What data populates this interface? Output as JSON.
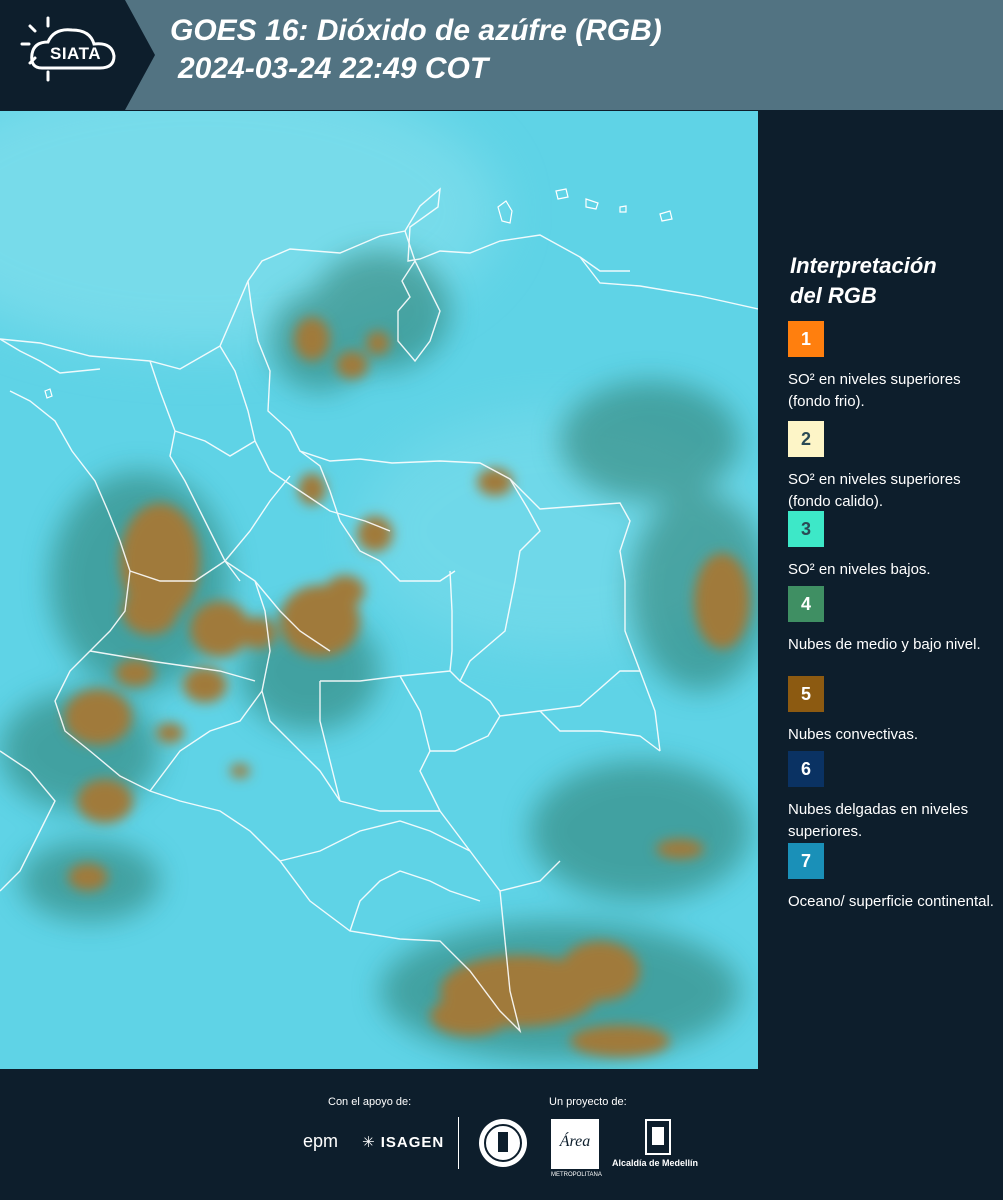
{
  "header": {
    "logo_text": "SIATA",
    "title_line1": "GOES 16: Dióxido de azúfre (RGB)",
    "title_line2": "2024-03-24 22:49 COT"
  },
  "map": {
    "background_color": "#5fd3e6",
    "convective_color": "#a07a3a",
    "border_color": "#ffffff"
  },
  "legend": {
    "title_line1": "Interpretación",
    "title_line2": "del RGB",
    "items": [
      {
        "number": "1",
        "color": "#ff7f0e",
        "label": "SO² en niveles superiores (fondo frio)."
      },
      {
        "number": "2",
        "color": "#fdf5c7",
        "label": "SO² en niveles superiores (fondo calido)."
      },
      {
        "number": "3",
        "color": "#3de8c8",
        "label": "SO² en niveles bajos."
      },
      {
        "number": "4",
        "color": "#3f8f63",
        "label": "Nubes de medio y bajo nivel."
      },
      {
        "number": "5",
        "color": "#8c5a11",
        "label": "Nubes convectivas."
      },
      {
        "number": "6",
        "color": "#0a3263",
        "label": "Nubes delgadas en niveles superiores."
      },
      {
        "number": "7",
        "color": "#1a90b8",
        "label": "Oceano/ superficie continental."
      }
    ]
  },
  "footer": {
    "support_label": "Con el apoyo de:",
    "project_label": "Un proyecto de:",
    "sponsor_epm": "epm",
    "sponsor_isagen": "ISAGEN",
    "area_logo_text": "Área",
    "area_sub": "METROPOLITANA",
    "alcaldia_label": "Alcaldía de Medellín"
  }
}
